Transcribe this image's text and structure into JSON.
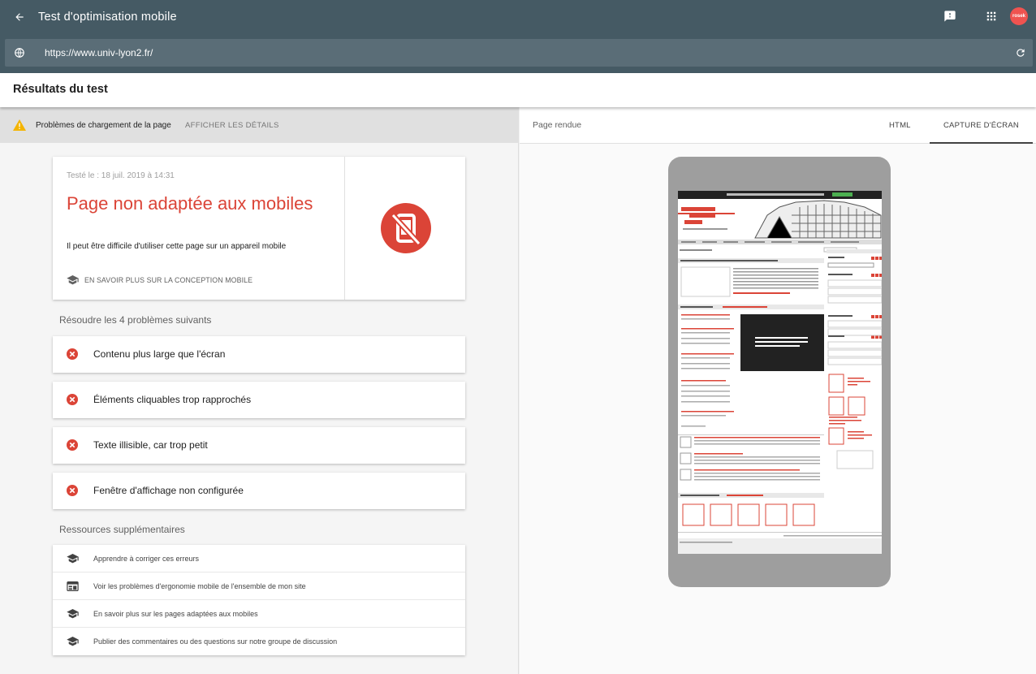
{
  "app": {
    "title": "Test d'optimisation mobile",
    "back_icon": "arrow-back-icon",
    "feedback_icon": "feedback-icon",
    "apps_icon": "apps-grid-icon",
    "avatar_text": "rosek",
    "avatar_color": "#ef5350"
  },
  "urlbar": {
    "value": "https://www.univ-lyon2.fr/",
    "globe_icon": "globe-icon",
    "reload_icon": "reload-icon"
  },
  "results": {
    "title": "Résultats du test"
  },
  "warning": {
    "label": "Problèmes de chargement de la page",
    "link": "AFFICHER LES DÉTAILS",
    "color": "#f4b400"
  },
  "verdict": {
    "tested": "Testé le : 18 juil. 2019 à 14:31",
    "title": "Page non adaptée aux mobiles",
    "subtitle": "Il peut être difficile d'utiliser cette page sur un appareil mobile",
    "learn_more": "EN SAVOIR PLUS SUR LA CONCEPTION MOBILE",
    "color": "#db4437"
  },
  "issues": {
    "heading": "Résoudre les 4 problèmes suivants",
    "items": [
      {
        "label": "Contenu plus large que l'écran"
      },
      {
        "label": "Éléments cliquables trop rapprochés"
      },
      {
        "label": "Texte illisible, car trop petit"
      },
      {
        "label": "Fenêtre d'affichage non configurée"
      }
    ]
  },
  "resources": {
    "heading": "Ressources supplémentaires",
    "items": [
      {
        "label": "Apprendre à corriger ces erreurs",
        "icon": "school-icon"
      },
      {
        "label": "Voir les problèmes d'ergonomie mobile de l'ensemble de mon site",
        "icon": "web-icon"
      },
      {
        "label": "En savoir plus sur les pages adaptées aux mobiles",
        "icon": "school-icon"
      },
      {
        "label": "Publier des commentaires ou des questions sur notre groupe de discussion",
        "icon": "school-icon"
      }
    ]
  },
  "rendered": {
    "title": "Page rendue",
    "tab_html": "HTML",
    "tab_screenshot": "CAPTURE D'ÉCRAN"
  }
}
